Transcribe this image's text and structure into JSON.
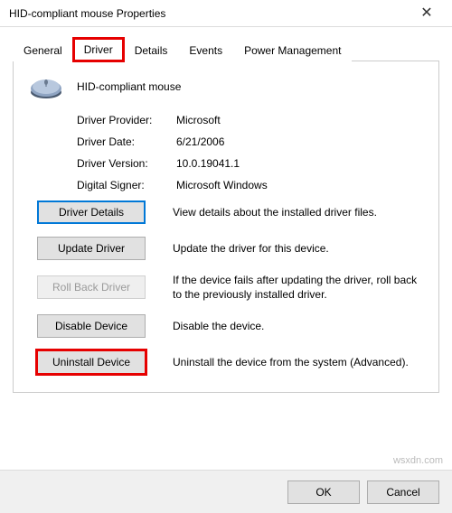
{
  "window": {
    "title": "HID-compliant mouse Properties"
  },
  "tabs": [
    {
      "label": "General"
    },
    {
      "label": "Driver"
    },
    {
      "label": "Details"
    },
    {
      "label": "Events"
    },
    {
      "label": "Power Management"
    }
  ],
  "device": {
    "name": "HID-compliant mouse"
  },
  "info": {
    "provider_label": "Driver Provider:",
    "provider_value": "Microsoft",
    "date_label": "Driver Date:",
    "date_value": "6/21/2006",
    "version_label": "Driver Version:",
    "version_value": "10.0.19041.1",
    "signer_label": "Digital Signer:",
    "signer_value": "Microsoft Windows"
  },
  "actions": {
    "details_btn": "Driver Details",
    "details_desc": "View details about the installed driver files.",
    "update_btn": "Update Driver",
    "update_desc": "Update the driver for this device.",
    "rollback_btn": "Roll Back Driver",
    "rollback_desc": "If the device fails after updating the driver, roll back to the previously installed driver.",
    "disable_btn": "Disable Device",
    "disable_desc": "Disable the device.",
    "uninstall_btn": "Uninstall Device",
    "uninstall_desc": "Uninstall the device from the system (Advanced)."
  },
  "footer": {
    "ok": "OK",
    "cancel": "Cancel"
  },
  "watermark": "wsxdn.com"
}
